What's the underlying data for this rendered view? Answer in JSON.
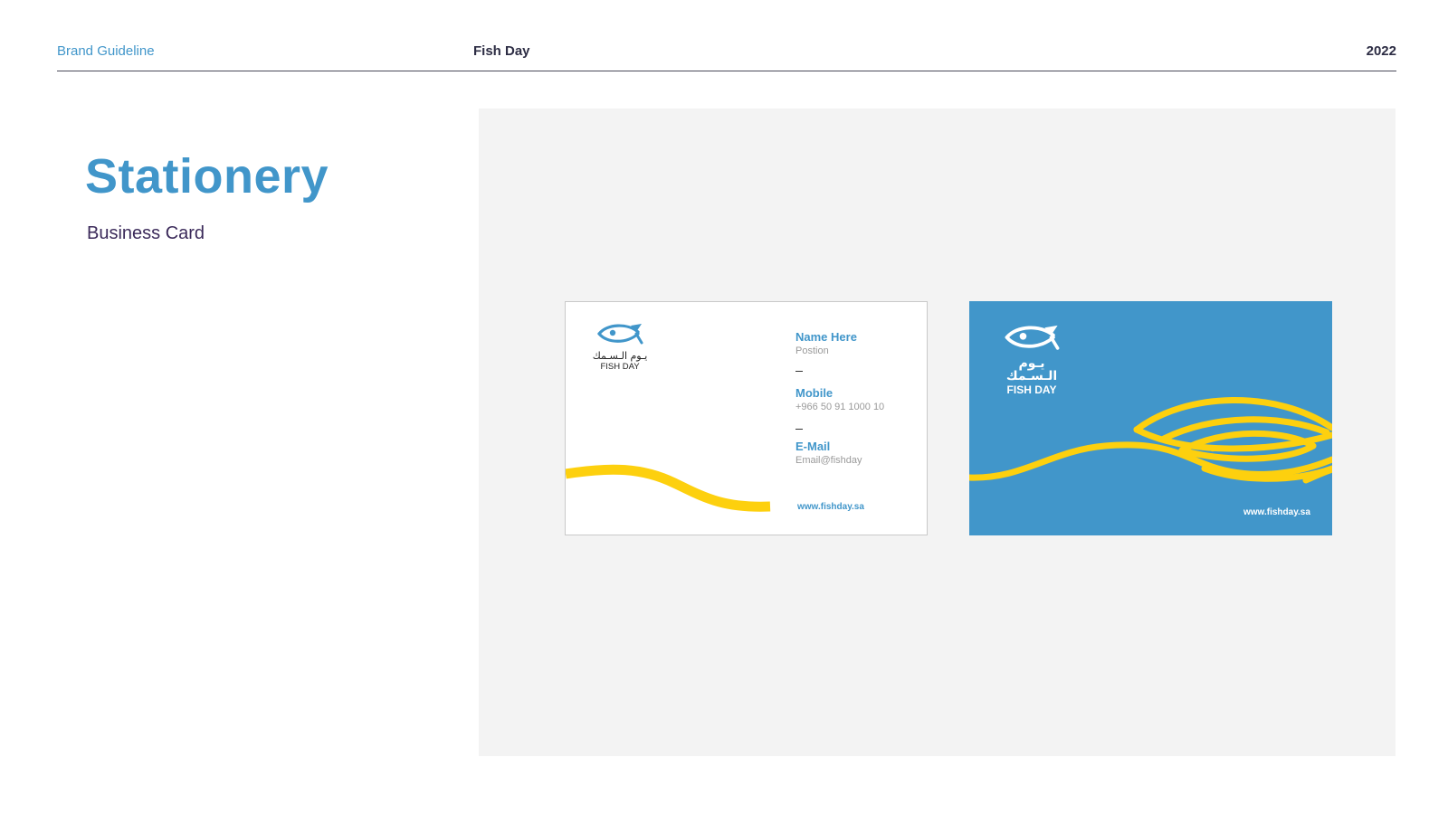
{
  "header": {
    "left_label": "Brand Guideline",
    "center_label": "Fish Day",
    "right_label": "2022"
  },
  "page": {
    "title": "Stationery",
    "subtitle": "Business Card"
  },
  "brand": {
    "arabic_name": "يـوم الـسـمك",
    "latin_name": "FISH DAY",
    "website": "www.fishday.sa",
    "colors": {
      "blue": "#4196ca",
      "yellow": "#fdd00e",
      "dark": "#2d2d44",
      "panel": "#f3f3f3"
    }
  },
  "card_front": {
    "name_label": "Name Here",
    "position_label": "Postion",
    "mobile_label": "Mobile",
    "mobile_value": "+966 50 91 1000 10",
    "email_label": "E-Mail",
    "email_value": "Email@fishday"
  },
  "icons": [
    "fish-logo-icon",
    "wave-graphic",
    "fish-lines-graphic"
  ]
}
